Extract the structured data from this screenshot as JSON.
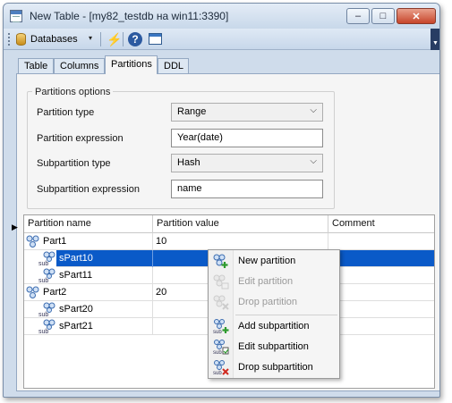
{
  "window": {
    "title": "New Table - [my82_testdb на win11:3390]",
    "min_glyph": "–",
    "max_glyph": "□",
    "close_glyph": "✕"
  },
  "toolbar": {
    "databases_label": "Databases",
    "dropdown_glyph": "▾",
    "bolt_glyph": "⚡",
    "help_glyph": "?",
    "overflow_glyph": "▼"
  },
  "tabs": [
    {
      "label": "Table",
      "active": false
    },
    {
      "label": "Columns",
      "active": false
    },
    {
      "label": "Partitions",
      "active": true
    },
    {
      "label": "DDL",
      "active": false
    }
  ],
  "partitions_options": {
    "title": "Partitions options",
    "partition_type": {
      "label": "Partition type",
      "value": "Range"
    },
    "partition_expression": {
      "label": "Partition expression",
      "value": "Year(date)"
    },
    "subpartition_type": {
      "label": "Subpartition type",
      "value": "Hash"
    },
    "subpartition_expression": {
      "label": "Subpartition expression",
      "value": "name"
    },
    "chevron_glyph": "⌵"
  },
  "grid": {
    "columns": [
      "Partition name",
      "Partition value",
      "Comment"
    ],
    "indicator_glyph": "▶",
    "rows": [
      {
        "kind": "partition",
        "name": "Part1",
        "value": "10",
        "comment": ""
      },
      {
        "kind": "subpartition",
        "name": "sPart10",
        "value": "",
        "comment": "",
        "selected": true
      },
      {
        "kind": "subpartition",
        "name": "sPart11",
        "value": "",
        "comment": ""
      },
      {
        "kind": "partition",
        "name": "Part2",
        "value": "20",
        "comment": ""
      },
      {
        "kind": "subpartition",
        "name": "sPart20",
        "value": "",
        "comment": ""
      },
      {
        "kind": "subpartition",
        "name": "sPart21",
        "value": "",
        "comment": ""
      }
    ],
    "sub_icon_text": "sub"
  },
  "context_menu": {
    "items": [
      {
        "label": "New partition",
        "enabled": true,
        "icon": "new-partition-icon"
      },
      {
        "label": "Edit partition",
        "enabled": false,
        "icon": "edit-partition-icon"
      },
      {
        "label": "Drop partition",
        "enabled": false,
        "icon": "drop-partition-icon"
      },
      {
        "label": "Add subpartition",
        "enabled": true,
        "icon": "add-subpartition-icon"
      },
      {
        "label": "Edit subpartition",
        "enabled": true,
        "icon": "edit-subpartition-icon"
      },
      {
        "label": "Drop subpartition",
        "enabled": true,
        "icon": "drop-subpartition-icon"
      }
    ]
  },
  "colors": {
    "selection": "#0a5ac8",
    "window_frame": "#cfdceb",
    "close_button": "#c7452a"
  }
}
